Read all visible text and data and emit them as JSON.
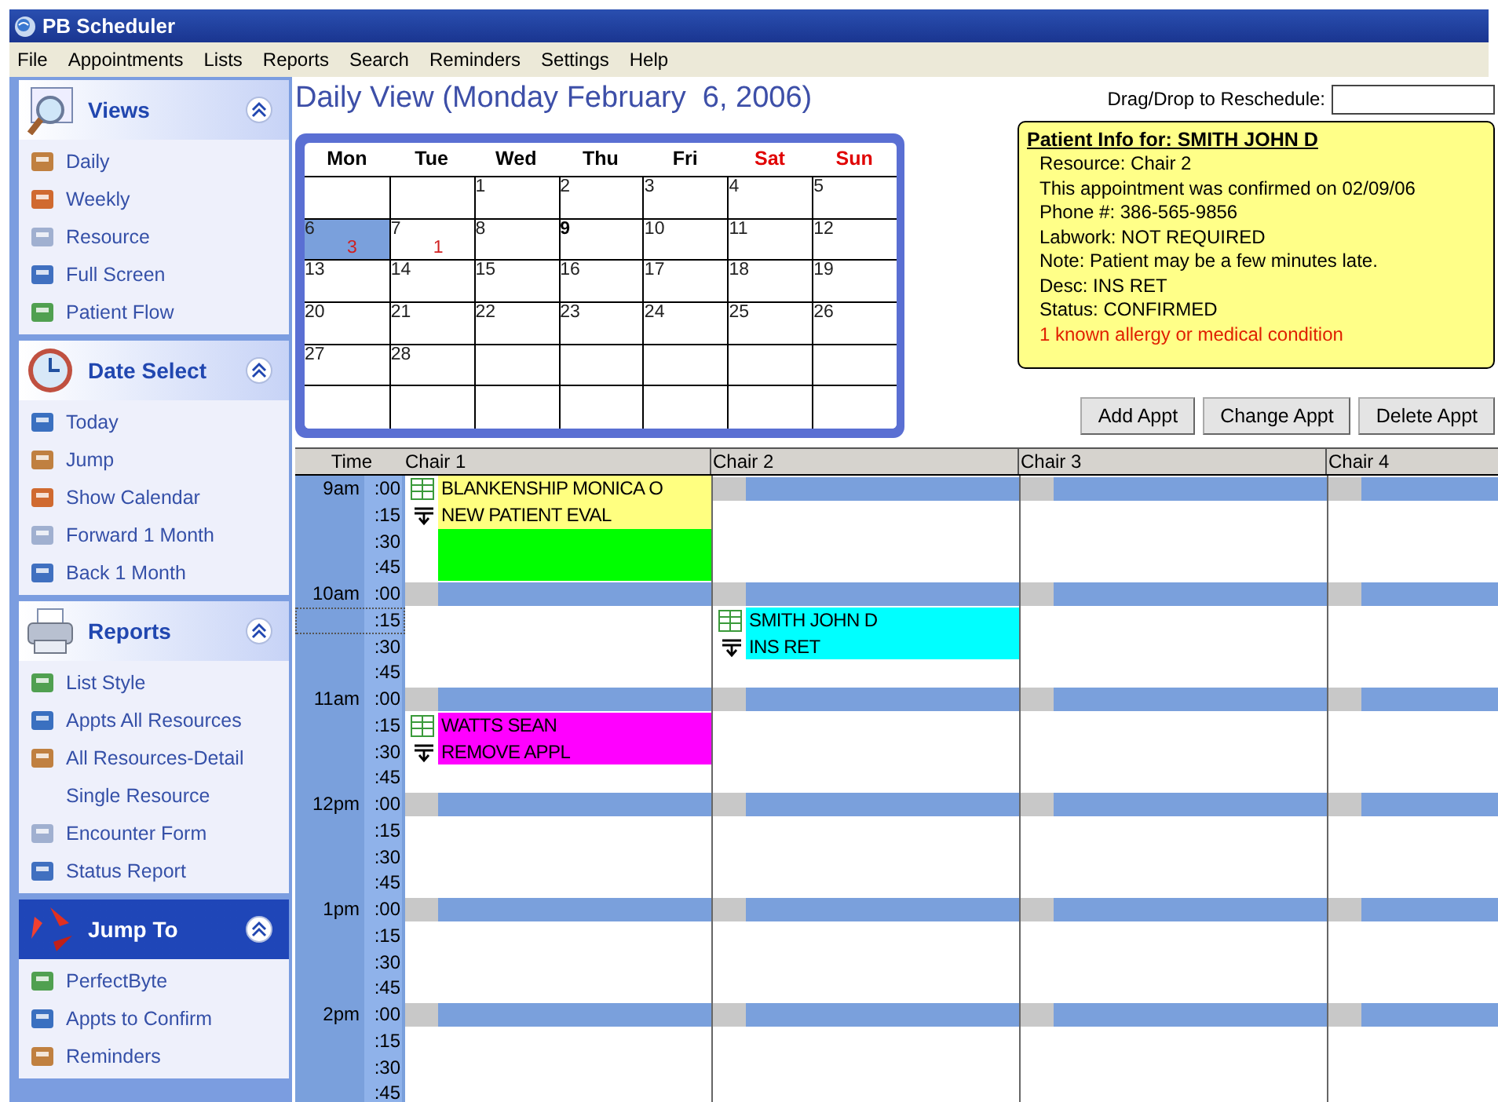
{
  "window": {
    "title": "PB Scheduler"
  },
  "menu": [
    "File",
    "Appointments",
    "Lists",
    "Reports",
    "Search",
    "Reminders",
    "Settings",
    "Help"
  ],
  "sidebar": {
    "sections": [
      {
        "title": "Views",
        "expanded": true,
        "highlighted": false,
        "items": [
          "Daily",
          "Weekly",
          "Resource",
          "Full Screen",
          "Patient Flow"
        ]
      },
      {
        "title": "Date Select",
        "expanded": true,
        "highlighted": false,
        "items": [
          "Today",
          "Jump",
          "Show Calendar",
          "Forward 1 Month",
          "Back 1 Month"
        ]
      },
      {
        "title": "Reports",
        "expanded": true,
        "highlighted": false,
        "items": [
          "List Style",
          "Appts All Resources",
          "All Resources-Detail",
          "Single Resource",
          "Encounter Form",
          "Status Report"
        ]
      },
      {
        "title": "Jump To",
        "expanded": true,
        "highlighted": true,
        "items": [
          "PerfectByte",
          "Appts to Confirm",
          "Reminders"
        ]
      }
    ]
  },
  "view_title": "Daily View (Monday February  6, 2006)",
  "drag_drop": {
    "label": "Drag/Drop to Reschedule:"
  },
  "calendar": {
    "weekdays": [
      {
        "label": "Mon",
        "weekend": false
      },
      {
        "label": "Tue",
        "weekend": false
      },
      {
        "label": "Wed",
        "weekend": false
      },
      {
        "label": "Thu",
        "weekend": false
      },
      {
        "label": "Fri",
        "weekend": false
      },
      {
        "label": "Sat",
        "weekend": true
      },
      {
        "label": "Sun",
        "weekend": true
      }
    ],
    "weeks": [
      [
        {
          "selected": false
        },
        {
          "selected": false
        },
        {
          "day": "1",
          "selected": false,
          "today": false
        },
        {
          "day": "2",
          "selected": false,
          "today": false
        },
        {
          "day": "3",
          "selected": false,
          "today": false
        },
        {
          "day": "4",
          "selected": false,
          "today": false
        },
        {
          "day": "5",
          "selected": false,
          "today": false
        }
      ],
      [
        {
          "day": "6",
          "count": "3",
          "selected": true,
          "today": false
        },
        {
          "day": "7",
          "count": "1",
          "selected": false,
          "today": false
        },
        {
          "day": "8",
          "selected": false,
          "today": false
        },
        {
          "day": "9",
          "selected": false,
          "today": true
        },
        {
          "day": "10",
          "selected": false,
          "today": false
        },
        {
          "day": "11",
          "selected": false,
          "today": false
        },
        {
          "day": "12",
          "selected": false,
          "today": false
        }
      ],
      [
        {
          "day": "13",
          "selected": false,
          "today": false
        },
        {
          "day": "14",
          "selected": false,
          "today": false
        },
        {
          "day": "15",
          "selected": false,
          "today": false
        },
        {
          "day": "16",
          "selected": false,
          "today": false
        },
        {
          "day": "17",
          "selected": false,
          "today": false
        },
        {
          "day": "18",
          "selected": false,
          "today": false
        },
        {
          "day": "19",
          "selected": false,
          "today": false
        }
      ],
      [
        {
          "day": "20",
          "selected": false,
          "today": false
        },
        {
          "day": "21",
          "selected": false,
          "today": false
        },
        {
          "day": "22",
          "selected": false,
          "today": false
        },
        {
          "day": "23",
          "selected": false,
          "today": false
        },
        {
          "day": "24",
          "selected": false,
          "today": false
        },
        {
          "day": "25",
          "selected": false,
          "today": false
        },
        {
          "day": "26",
          "selected": false,
          "today": false
        }
      ],
      [
        {
          "day": "27",
          "selected": false,
          "today": false
        },
        {
          "day": "28",
          "selected": false,
          "today": false
        },
        {
          "selected": false
        },
        {
          "selected": false
        },
        {
          "selected": false
        },
        {
          "selected": false
        },
        {
          "selected": false
        }
      ],
      [
        {
          "selected": false
        },
        {
          "selected": false
        },
        {
          "selected": false
        },
        {
          "selected": false
        },
        {
          "selected": false
        },
        {
          "selected": false
        },
        {
          "selected": false
        }
      ]
    ]
  },
  "patient_info": {
    "title": "Patient Info for: SMITH JOHN D",
    "lines": [
      {
        "text": "Resource: Chair 2",
        "alert": false
      },
      {
        "text": "This appointment was confirmed on 02/09/06",
        "alert": false
      },
      {
        "text": "Phone #: 386-565-9856",
        "alert": false
      },
      {
        "text": "Labwork: NOT REQUIRED",
        "alert": false
      },
      {
        "text": "Note: Patient may be a few minutes late.",
        "alert": false
      },
      {
        "text": "Desc: INS RET",
        "alert": false
      },
      {
        "text": "Status: CONFIRMED",
        "alert": false
      },
      {
        "text": "1 known allergy or medical condition",
        "alert": true
      }
    ]
  },
  "buttons": [
    "Add Appt",
    "Change Appt",
    "Delete Appt"
  ],
  "schedule": {
    "time_header": "Time",
    "chairs": [
      {
        "name": "Chair 1",
        "appointments": [
          {
            "patient": "BLANKENSHIP MONICA O",
            "description": "NEW PATIENT EVAL",
            "color": "#ffff80"
          },
          {
            "color": "#00ff00"
          },
          {
            "patient": "WATTS SEAN",
            "description": "REMOVE APPL",
            "color": "#ff00ff"
          }
        ]
      },
      {
        "name": "Chair 2",
        "appointments": [
          {
            "patient": "SMITH JOHN D",
            "description": "INS RET",
            "color": "#00ffff"
          }
        ]
      },
      {
        "name": "Chair 3"
      },
      {
        "name": "Chair 4"
      }
    ],
    "rows": [
      {
        "hour": "9am",
        "minute": ":00",
        "selected": false
      },
      {
        "minute": ":15",
        "selected": false
      },
      {
        "minute": ":30",
        "selected": false
      },
      {
        "minute": ":45",
        "selected": false
      },
      {
        "hour": "10am",
        "minute": ":00",
        "selected": false
      },
      {
        "minute": ":15",
        "selected": true
      },
      {
        "minute": ":30",
        "selected": false
      },
      {
        "minute": ":45",
        "selected": false
      },
      {
        "hour": "11am",
        "minute": ":00",
        "selected": false
      },
      {
        "minute": ":15",
        "selected": false
      },
      {
        "minute": ":30",
        "selected": false
      },
      {
        "minute": ":45",
        "selected": false
      },
      {
        "hour": "12pm",
        "minute": ":00",
        "selected": false
      },
      {
        "minute": ":15",
        "selected": false
      },
      {
        "minute": ":30",
        "selected": false
      },
      {
        "minute": ":45",
        "selected": false
      },
      {
        "hour": "1pm",
        "minute": ":00",
        "selected": false
      },
      {
        "minute": ":15",
        "selected": false
      },
      {
        "minute": ":30",
        "selected": false
      },
      {
        "minute": ":45",
        "selected": false
      },
      {
        "hour": "2pm",
        "minute": ":00",
        "selected": false
      },
      {
        "minute": ":15",
        "selected": false
      },
      {
        "minute": ":30",
        "selected": false
      },
      {
        "minute": ":45",
        "selected": false
      }
    ]
  }
}
